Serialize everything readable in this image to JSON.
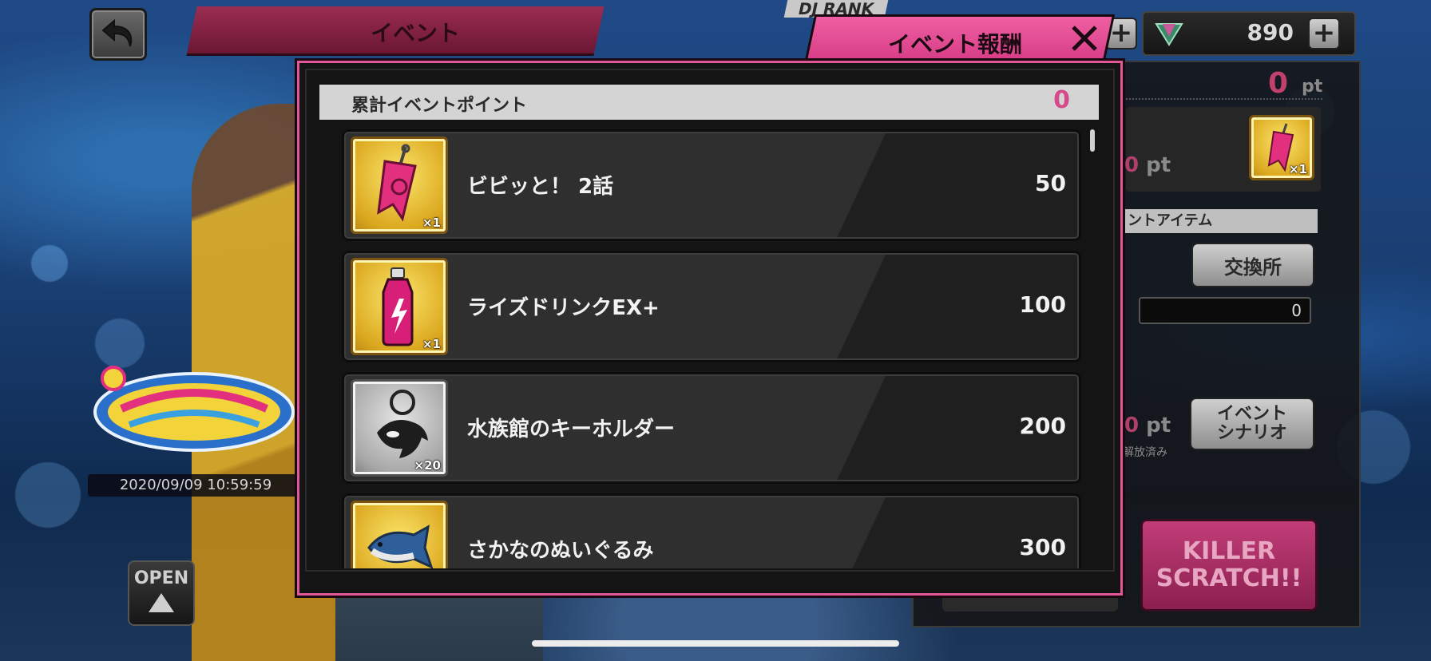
{
  "header": {
    "event_tab": "イベント",
    "dj_rank": "DJ RANK",
    "gem_count": "890"
  },
  "modal": {
    "title": "イベント報酬",
    "total_label": "累計イベントポイント",
    "total_value": "0",
    "rewards": [
      {
        "name": "ビビッと！ 2話",
        "points": "50",
        "qty": "×1",
        "frame": "gold",
        "icon": "pennant-ticket-icon"
      },
      {
        "name": "ライズドリンクEX+",
        "points": "100",
        "qty": "×1",
        "frame": "gold",
        "icon": "energy-drink-icon"
      },
      {
        "name": "水族館のキーホルダー",
        "points": "200",
        "qty": "×20",
        "frame": "silver",
        "icon": "orca-keychain-icon"
      },
      {
        "name": "さかなのぬいぐるみ",
        "points": "300",
        "qty": "",
        "frame": "gold",
        "icon": "fish-plush-icon"
      }
    ]
  },
  "right_panel": {
    "points_value": "0",
    "points_unit": "pt",
    "reward_points_value": "0",
    "reward_points_unit": "pt",
    "reward_qty": "×1",
    "item_header": "ントアイテム",
    "exchange_button": "交換所",
    "token_count": "0",
    "scenario_points_value": "0",
    "scenario_points_unit": "pt",
    "unlocked_label": "解放済み",
    "scenario_button_line1": "イベント",
    "scenario_button_line2": "シナリオ",
    "killer_line1": "KILLER",
    "killer_line2": "SCRATCH!!"
  },
  "left": {
    "event_date": "2020/09/09 10:59:59",
    "open_button": "OPEN"
  },
  "colors": {
    "accent_pink": "#e25797",
    "points_pink": "#d44a8a",
    "event_tab": "#9a2d52"
  }
}
